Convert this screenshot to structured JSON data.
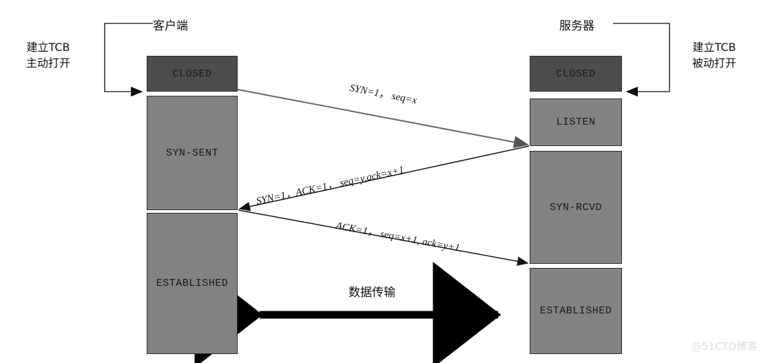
{
  "diagram": {
    "title_client": "客户端",
    "title_server": "服务器",
    "note_left": {
      "line1": "建立TCB",
      "line2": "主动打开"
    },
    "note_right": {
      "line1": "建立TCB",
      "line2": "被动打开"
    },
    "watermark": "@51CTO博客",
    "colors": {
      "box_dark": "#4d4d4d",
      "box_light": "#828282",
      "border": "#2b2b2b",
      "arrow_gray": "#666666",
      "arrow_black": "#111111",
      "background": "#ffffff"
    }
  },
  "client_states": [
    {
      "label": "CLOSED",
      "shade": "dark"
    },
    {
      "label": "SYN-SENT",
      "shade": "light"
    },
    {
      "label": "ESTABLISHED",
      "shade": "light"
    }
  ],
  "server_states": [
    {
      "label": "CLOSED",
      "shade": "dark"
    },
    {
      "label": "LISTEN",
      "shade": "light"
    },
    {
      "label": "SYN-RCVD",
      "shade": "light"
    },
    {
      "label": "ESTABLISHED",
      "shade": "light"
    }
  ],
  "messages": [
    {
      "id": "syn",
      "label": "SYN=1，  seq=x",
      "direction": "client-to-server"
    },
    {
      "id": "synack",
      "label": "SYN=1，ACK=1，  seq=y,ack=x+1",
      "direction": "server-to-client"
    },
    {
      "id": "ack",
      "label": "ACK=1，  seq=x+1, ack=y+1",
      "direction": "client-to-server"
    }
  ],
  "data_transfer": {
    "label": "数据传输"
  }
}
